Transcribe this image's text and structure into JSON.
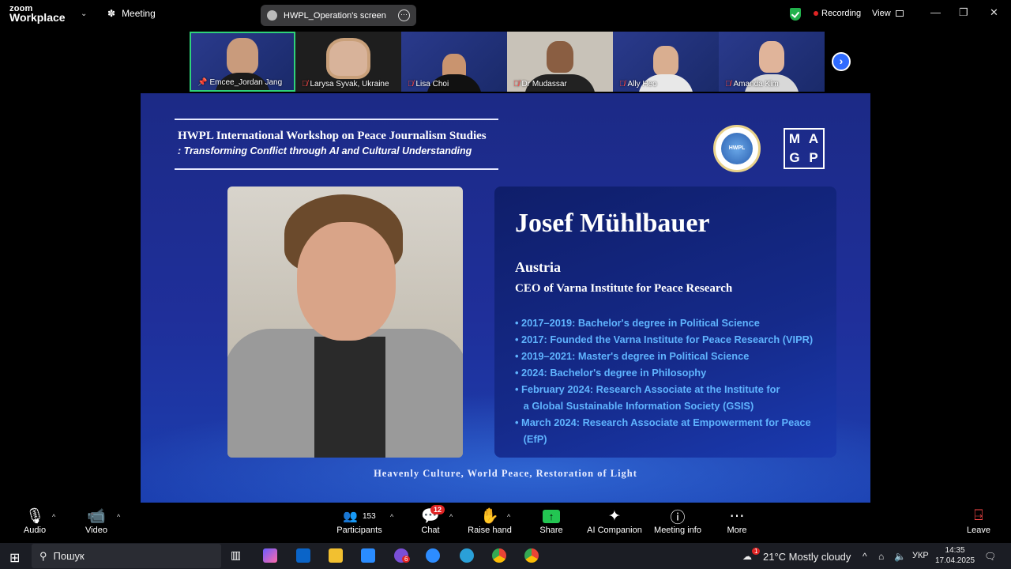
{
  "app": {
    "logo_line1": "zoom",
    "logo_line2": "Workplace"
  },
  "topbar": {
    "meeting_label": "Meeting",
    "share_title": "HWPL_Operation's screen",
    "recording_label": "Recording",
    "view_label": "View",
    "recording_color": "#e02424",
    "security_color": "#22b14c"
  },
  "participants_strip": [
    {
      "name": "Emcee_Jordan Jang",
      "pinned": true,
      "muted": false
    },
    {
      "name": "Larysa Syvak, Ukraine",
      "muted": true
    },
    {
      "name": "Lisa Choi",
      "muted": true
    },
    {
      "name": "Dr Mudassar",
      "muted": true
    },
    {
      "name": "Ally Heo",
      "muted": true
    },
    {
      "name": "Amanda Kim",
      "muted": true
    }
  ],
  "slide": {
    "header_title": "HWPL International Workshop on Peace Journalism Studies",
    "header_subtitle": ": Transforming Conflict through AI and Cultural Understanding",
    "logo1_text": "HWPL",
    "logo2_letters": [
      "M",
      "A",
      "G",
      "P"
    ],
    "person_name": "Josef Mühlbauer",
    "country": "Austria",
    "role": "CEO of Varna Institute for Peace Research",
    "bullets": [
      "• 2017–2019: Bachelor's degree in Political Science",
      "• 2017: Founded the Varna Institute for Peace Research (VIPR)",
      "• 2019–2021: Master's degree in Political Science",
      "• 2024: Bachelor's degree in Philosophy",
      "• February 2024: Research Associate at the Institute for",
      "   a Global Sustainable Information Society (GSIS)",
      "• March 2024: Research Associate at Empowerment for Peace",
      "   (EfP)"
    ],
    "footer": "Heavenly Culture, World Peace, Restoration of Light",
    "bullet_color": "#5fb4ff"
  },
  "toolbar": {
    "audio": "Audio",
    "video": "Video",
    "participants": "Participants",
    "participants_count": "153",
    "chat": "Chat",
    "chat_badge": "12",
    "raise_hand": "Raise hand",
    "share": "Share",
    "ai_companion": "AI Companion",
    "meeting_info": "Meeting info",
    "more": "More",
    "leave": "Leave"
  },
  "taskbar": {
    "search_placeholder": "Пошук",
    "weather": "21°C  Mostly cloudy",
    "language": "УКР",
    "time": "14:35",
    "date": "17.04.2025",
    "viber_badge": "6",
    "weather_badge": "1"
  }
}
